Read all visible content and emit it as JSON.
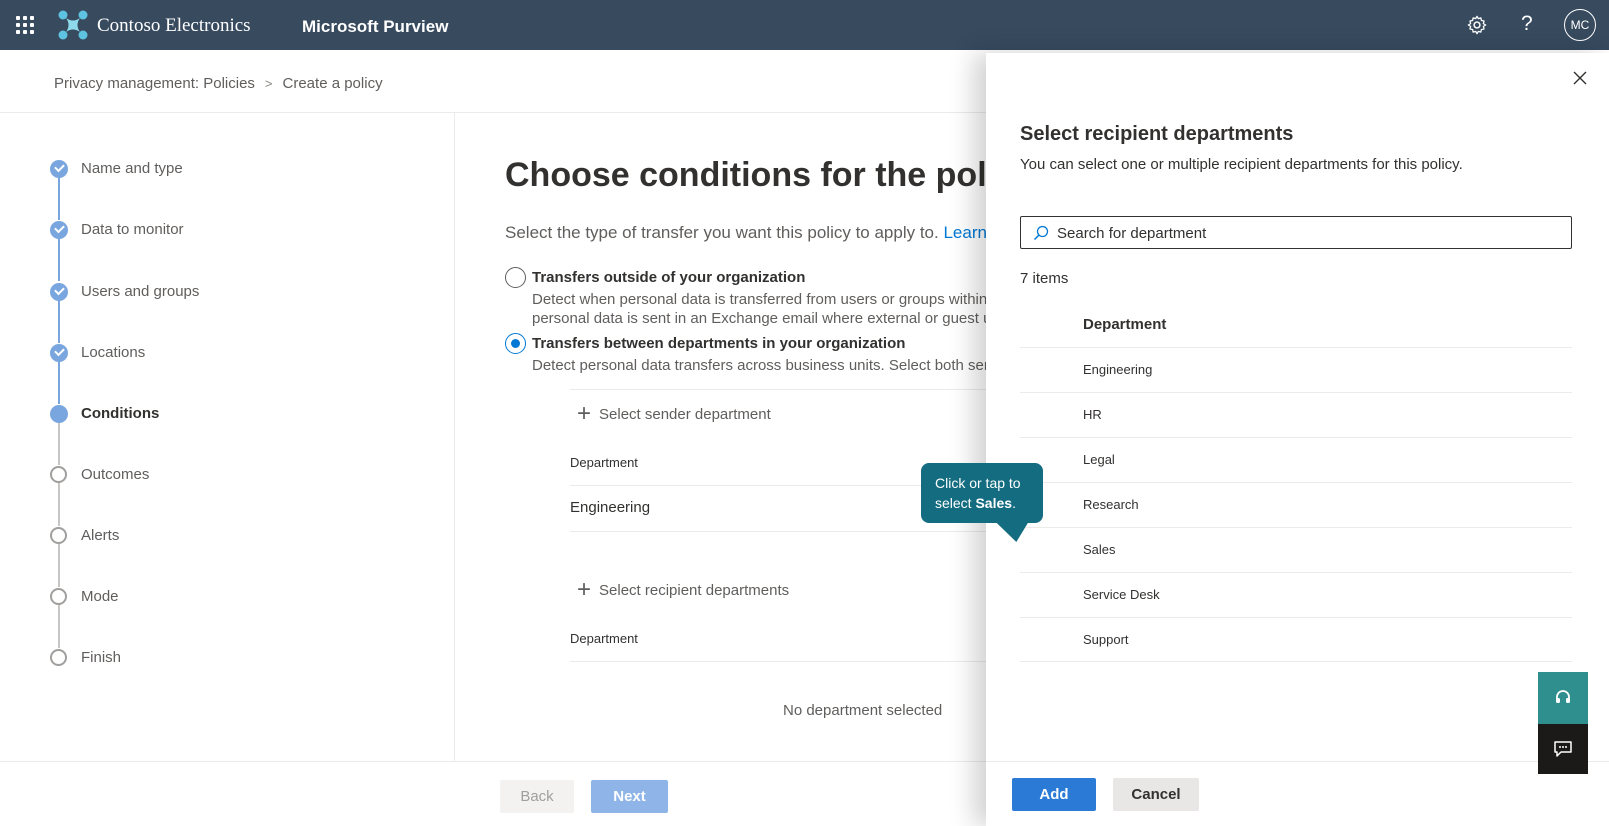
{
  "topbar": {
    "org_name": "Contoso Electronics",
    "app_name": "Microsoft Purview",
    "avatar_initials": "MC",
    "help_glyph": "?",
    "bg_color": "#374a5e"
  },
  "breadcrumb": {
    "items": [
      "Privacy management: Policies",
      "Create a policy"
    ],
    "separator": ">"
  },
  "stepper": {
    "steps": [
      {
        "label": "Name and type",
        "state": "done"
      },
      {
        "label": "Data to monitor",
        "state": "done"
      },
      {
        "label": "Users and groups",
        "state": "done"
      },
      {
        "label": "Locations",
        "state": "done"
      },
      {
        "label": "Conditions",
        "state": "current"
      },
      {
        "label": "Outcomes",
        "state": "todo"
      },
      {
        "label": "Alerts",
        "state": "todo"
      },
      {
        "label": "Mode",
        "state": "todo"
      },
      {
        "label": "Finish",
        "state": "todo"
      }
    ]
  },
  "main": {
    "title": "Choose conditions for the polic",
    "description": "Select the type of transfer you want this policy to apply to.",
    "learn_link": "Learn m",
    "options": [
      {
        "title": "Transfers outside of your organization",
        "desc_line1": "Detect when personal data is transferred from users or groups within y",
        "desc_line2": "personal data is sent in an Exchange email where external or guest use",
        "selected": false
      },
      {
        "title": "Transfers between departments in your organization",
        "desc_line1": "Detect personal data transfers across business units. Select both sende",
        "selected": true
      }
    ],
    "sender": {
      "add_label": "Select sender department",
      "column_header": "Department",
      "rows": [
        "Engineering"
      ]
    },
    "recipient": {
      "add_label": "Select recipient departments",
      "column_header": "Department",
      "empty_text": "No department selected"
    }
  },
  "footer": {
    "back_label": "Back",
    "next_label": "Next"
  },
  "panel": {
    "title": "Select recipient departments",
    "subtitle": "You can select one or multiple recipient departments for this policy.",
    "search_placeholder": "Search for department",
    "item_count": "7 items",
    "column_header": "Department",
    "departments": [
      "Engineering",
      "HR",
      "Legal",
      "Research",
      "Sales",
      "Service Desk",
      "Support"
    ],
    "add_label": "Add",
    "cancel_label": "Cancel"
  },
  "callout": {
    "text_prefix": "Click or tap to select ",
    "text_bold": "Sales",
    "text_suffix": "."
  },
  "colors": {
    "accent": "#0078d4",
    "step_done": "#7aa6e0",
    "callout_bg": "#146c80",
    "add_button": "#2b7ad6"
  }
}
